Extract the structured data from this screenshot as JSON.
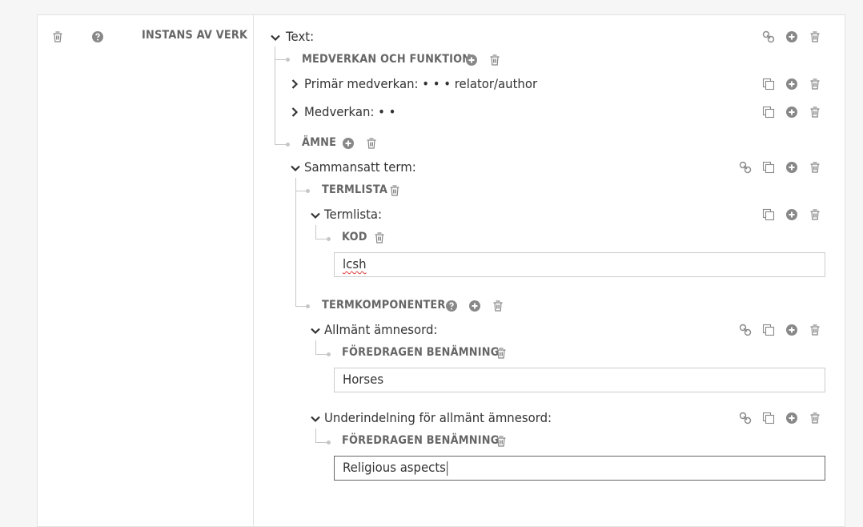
{
  "left_panel": {
    "property_label": "INSTANS AV VERK"
  },
  "tree": {
    "text_node": "Text:",
    "contribution_label": "MEDVERKAN OCH FUNKTION",
    "primary_contribution": "Primär medverkan: • • • relator/author",
    "contribution": "Medverkan: • •",
    "subject_label": "ÄMNE",
    "complex_term": "Sammansatt term:",
    "termlist_label": "TERMLISTA",
    "termlist_node": "Termlista:",
    "code_label": "KOD",
    "code_value": "lcsh",
    "term_components_label": "TERMKOMPONENTER",
    "general_subject": "Allmänt ämnesord:",
    "preferred_label_1": "FÖREDRAGEN BENÄMNING",
    "preferred_value_1": "Horses",
    "general_subdivision": "Underindelning för allmänt ämnesord:",
    "preferred_label_2": "FÖREDRAGEN BENÄMNING",
    "preferred_value_2": "Religious aspects"
  },
  "colors": {
    "icon": "#888888",
    "line": "#c6c6c6",
    "label": "#666666",
    "text": "#333333"
  }
}
